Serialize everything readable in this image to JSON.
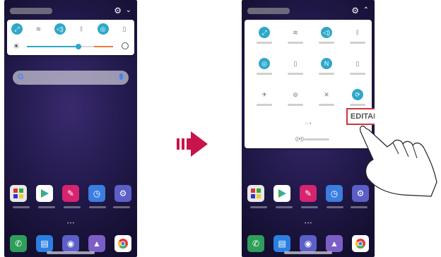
{
  "colors": {
    "accent": "#2ea8c9",
    "highlight": "#d0353c",
    "arrow": "#c8144c",
    "slider_end": "#f07a3a"
  },
  "left_phone": {
    "status": {
      "settings_icon": "gear-icon",
      "expand_icon": "chevron-down-icon"
    },
    "quick_settings": {
      "icons": [
        {
          "name": "rotate-icon",
          "on": true
        },
        {
          "name": "wifi-icon",
          "on": false
        },
        {
          "name": "sound-icon",
          "on": true
        },
        {
          "name": "bluetooth-icon",
          "on": false
        },
        {
          "name": "location-icon",
          "on": true
        },
        {
          "name": "screen-off-icon",
          "on": false
        }
      ],
      "brightness": {
        "level": 0.6,
        "sun_icon": "brightness-icon",
        "auto_icon": "auto-brightness-icon"
      }
    },
    "search": {
      "logo": "G",
      "mic_icon": "mic-icon"
    },
    "home_dots": "• • •"
  },
  "right_phone": {
    "status": {
      "settings_icon": "gear-icon",
      "collapse_icon": "chevron-up-icon"
    },
    "tiles": [
      {
        "name": "rotate-icon",
        "on": true
      },
      {
        "name": "wifi-icon",
        "on": false
      },
      {
        "name": "sound-icon",
        "on": true
      },
      {
        "name": "bluetooth-icon",
        "on": false
      },
      {
        "name": "location-icon",
        "on": true
      },
      {
        "name": "screen-off-icon",
        "on": false
      },
      {
        "name": "nfc-icon",
        "on": true
      },
      {
        "name": "flashlight-icon",
        "on": false
      },
      {
        "name": "airplane-icon",
        "on": false
      },
      {
        "name": "hotspot-icon",
        "on": false
      },
      {
        "name": "silent-icon",
        "on": false
      },
      {
        "name": "sync-icon",
        "on": true
      }
    ],
    "page_dots": "○ •",
    "edit_label": "EDITAR",
    "home_dots": "• • •"
  }
}
